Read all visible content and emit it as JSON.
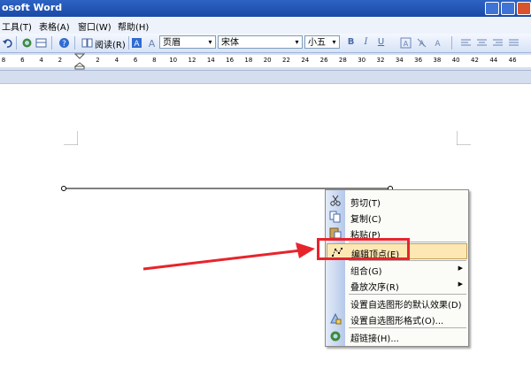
{
  "titlebar": {
    "title": "osoft Word"
  },
  "menubar": {
    "items": [
      "工具(T)",
      "表格(A)",
      "窗口(W)",
      "帮助(H)"
    ]
  },
  "toolbar": {
    "read_label": "阅读(R)",
    "style_value": "页眉",
    "font_value": "宋体",
    "size_value": "小五",
    "bold": "B",
    "italic": "I",
    "underline": "U",
    "arrow_glyph": "▾"
  },
  "ruler": {
    "ticks": [
      "8",
      "6",
      "4",
      "2",
      "",
      "2",
      "4",
      "6",
      "8",
      "10",
      "12",
      "14",
      "16",
      "18",
      "20",
      "22",
      "24",
      "26",
      "28",
      "30",
      "32",
      "34",
      "36",
      "38",
      "40",
      "42",
      "44",
      "46"
    ]
  },
  "context_menu": {
    "items": [
      {
        "label": "剪切(T)",
        "icon": "scissors-icon"
      },
      {
        "label": "复制(C)",
        "icon": "copy-icon"
      },
      {
        "label": "粘贴(P)",
        "icon": "paste-icon"
      },
      {
        "label": "编辑顶点(E)",
        "icon": "edit-points-icon",
        "highlighted": true
      },
      {
        "label": "组合(G)",
        "submenu": true
      },
      {
        "label": "叠放次序(R)",
        "submenu": true
      },
      {
        "label": "设置自选图形的默认效果(D)"
      },
      {
        "label": "设置自选图形格式(O)...",
        "icon": "format-shape-icon"
      },
      {
        "label": "超链接(H)...",
        "icon": "hyperlink-icon"
      }
    ],
    "submenu_glyph": "▶"
  },
  "colors": {
    "highlight": "#fde8b4",
    "red_annotation": "#e8242b",
    "titlebar": "#2d63c4"
  }
}
